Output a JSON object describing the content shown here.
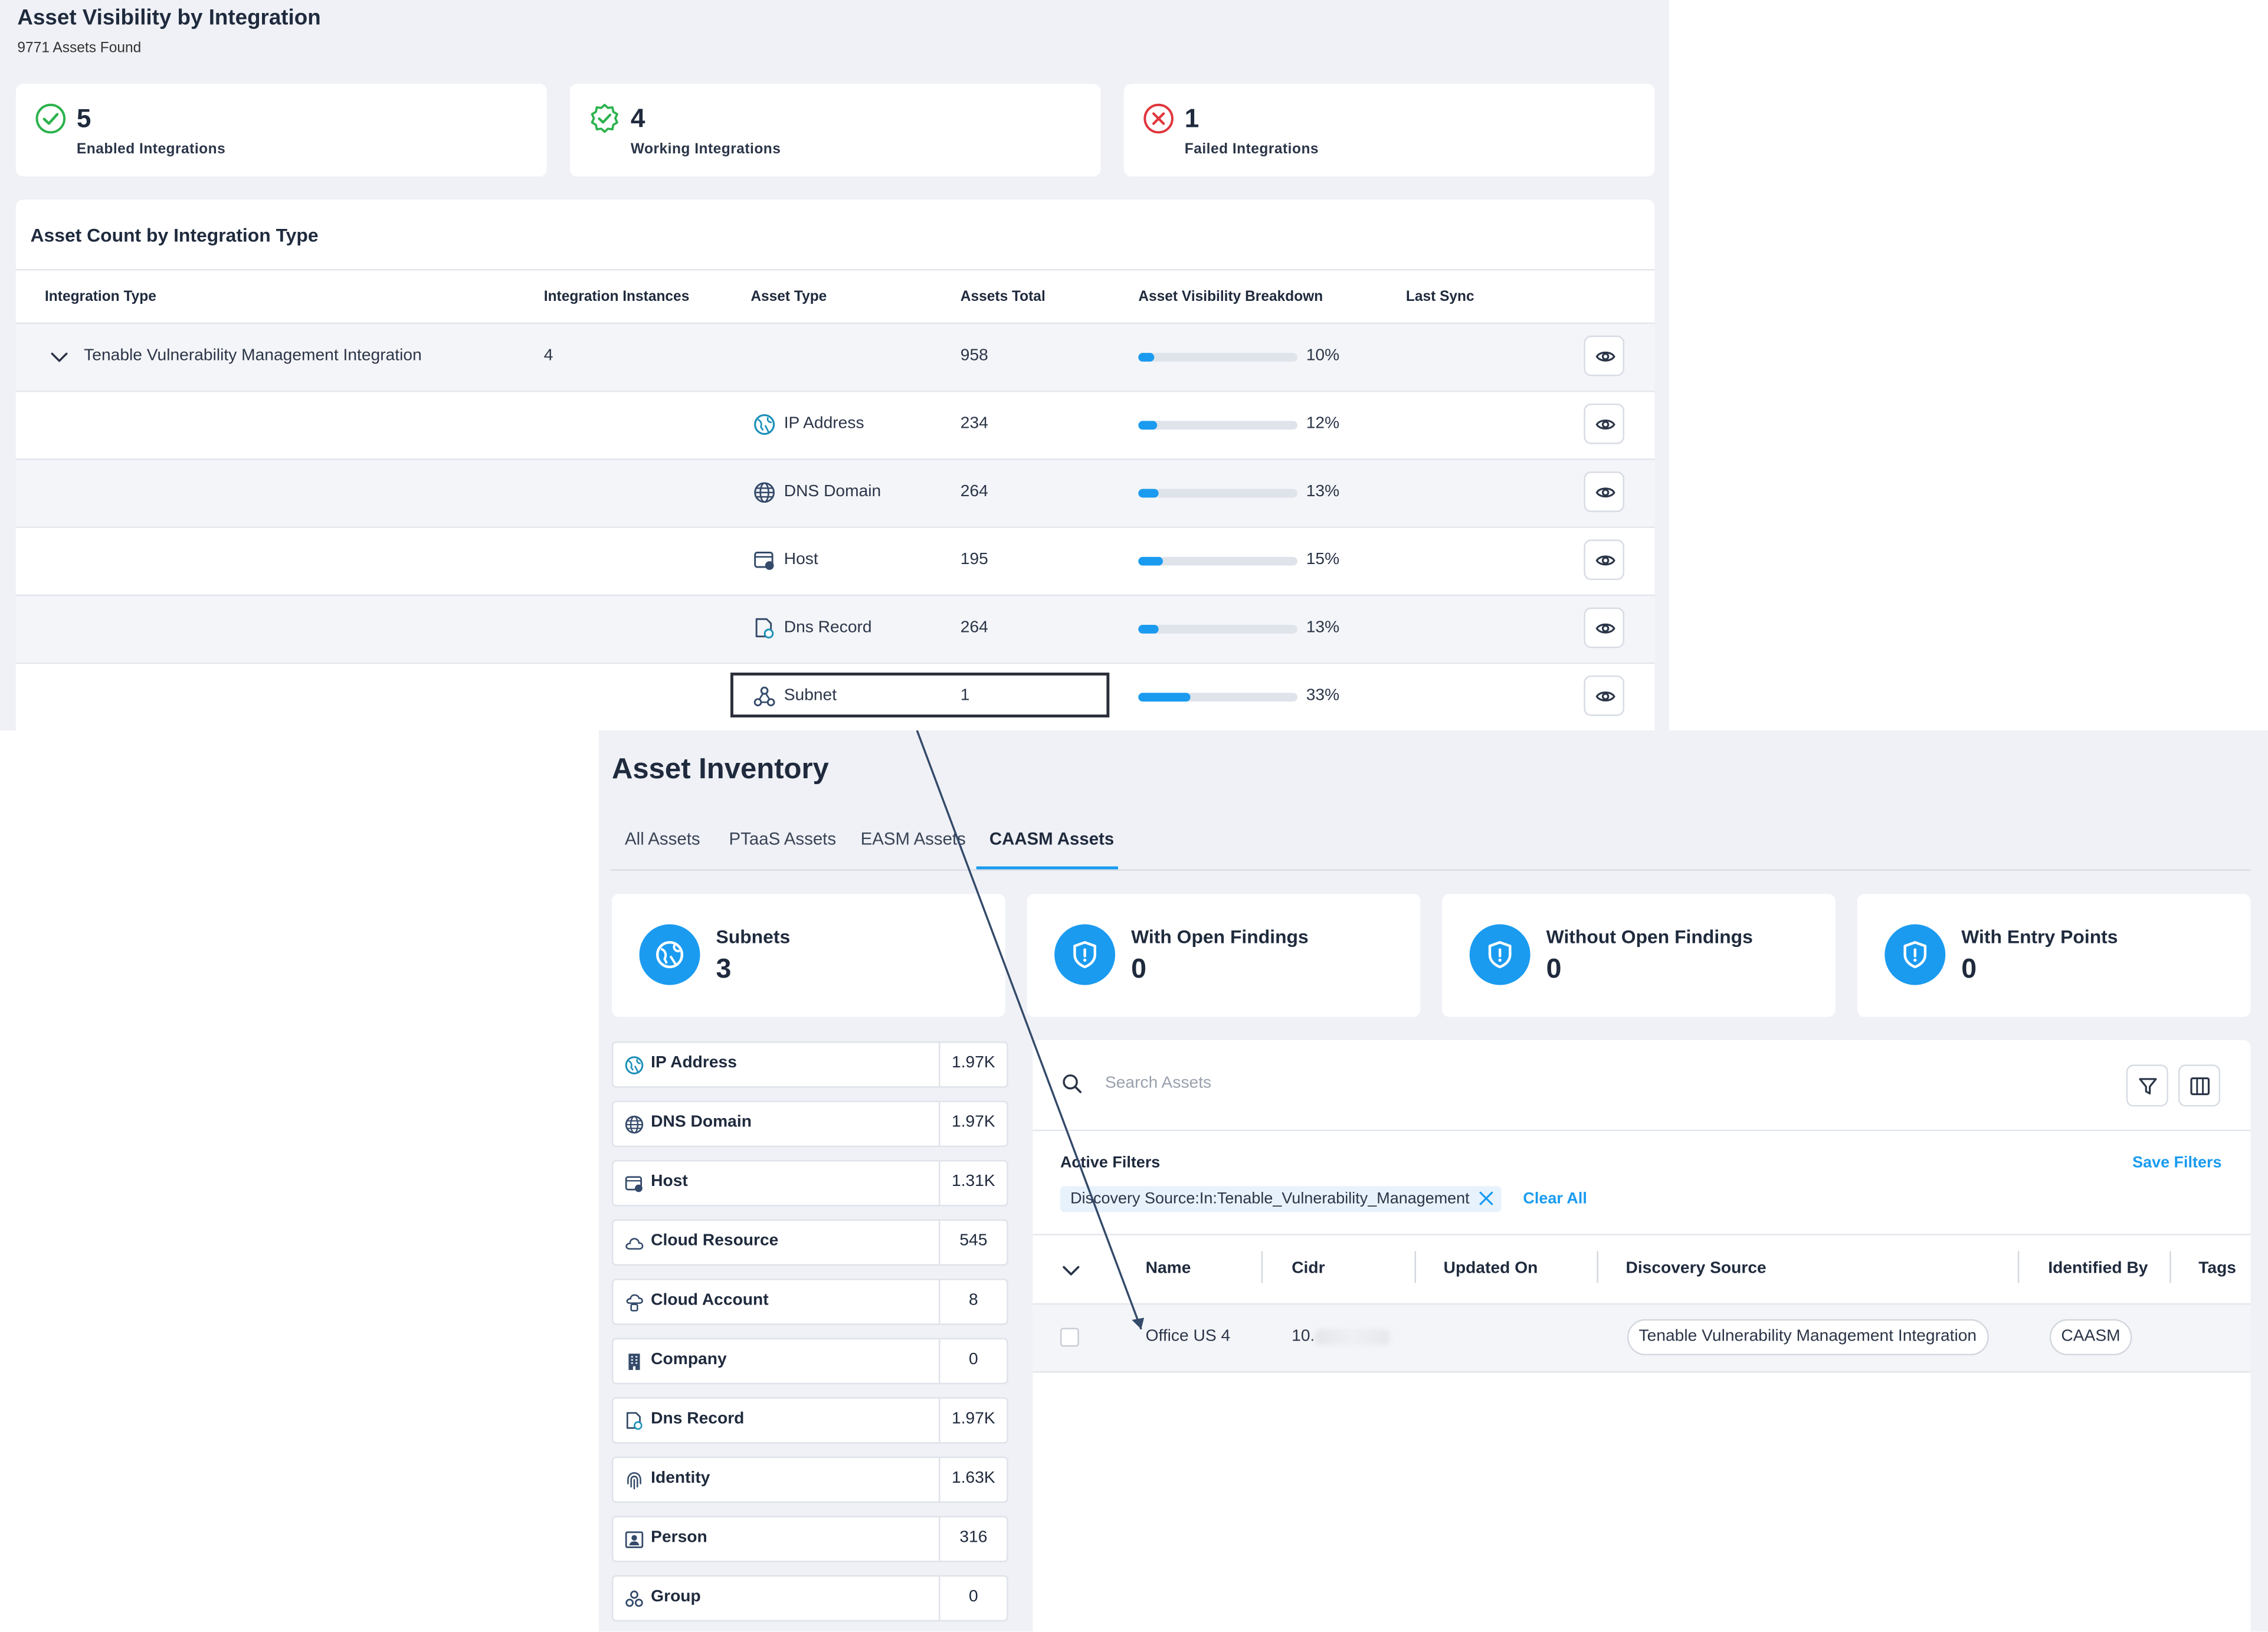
{
  "visibility": {
    "title": "Asset Visibility by Integration",
    "assets_found": "9771 Assets Found",
    "stats": [
      {
        "icon": "check-circle-icon",
        "value": "5",
        "label": "Enabled Integrations",
        "color": "#2bb24c"
      },
      {
        "icon": "verified-badge-icon",
        "value": "4",
        "label": "Working Integrations",
        "color": "#2bb24c"
      },
      {
        "icon": "failed-x-circle-icon",
        "value": "1",
        "label": "Failed Integrations",
        "color": "#e0353b"
      }
    ],
    "table": {
      "title": "Asset Count by Integration Type",
      "headers": {
        "integration_type": "Integration Type",
        "instances": "Integration Instances",
        "asset_type": "Asset Type",
        "assets_total": "Assets Total",
        "breakdown": "Asset Visibility Breakdown",
        "last_sync": "Last Sync"
      },
      "parent_row": {
        "integration": "Tenable Vulnerability Management Integration",
        "instances": "4",
        "total": "958",
        "percent": "10%",
        "fill": 0.1
      },
      "rows": [
        {
          "icon": "ip-address-icon",
          "asset_type": "IP Address",
          "total": "234",
          "percent": "12%",
          "fill": 0.12
        },
        {
          "icon": "dns-domain-globe-icon",
          "asset_type": "DNS Domain",
          "total": "264",
          "percent": "13%",
          "fill": 0.13
        },
        {
          "icon": "host-icon",
          "asset_type": "Host",
          "total": "195",
          "percent": "15%",
          "fill": 0.15
        },
        {
          "icon": "dns-record-icon",
          "asset_type": "Dns Record",
          "total": "264",
          "percent": "13%",
          "fill": 0.13
        },
        {
          "icon": "subnet-icon",
          "asset_type": "Subnet",
          "total": "1",
          "percent": "33%",
          "fill": 0.33
        }
      ]
    }
  },
  "inventory": {
    "title": "Asset Inventory",
    "tabs": [
      "All Assets",
      "PTaaS Assets",
      "EASM Assets",
      "CAASM Assets"
    ],
    "active_tab": "CAASM Assets",
    "kpis": [
      {
        "icon": "subnet-globe-icon",
        "label": "Subnets",
        "value": "3"
      },
      {
        "icon": "shield-alert-icon",
        "label": "With Open Findings",
        "value": "0"
      },
      {
        "icon": "shield-alert-icon",
        "label": "Without Open Findings",
        "value": "0"
      },
      {
        "icon": "shield-alert-icon",
        "label": "With Entry Points",
        "value": "0"
      }
    ],
    "asset_types": [
      {
        "icon": "ip-address-icon",
        "label": "IP Address",
        "count": "1.97K"
      },
      {
        "icon": "dns-domain-globe-icon",
        "label": "DNS Domain",
        "count": "1.97K"
      },
      {
        "icon": "host-icon",
        "label": "Host",
        "count": "1.31K"
      },
      {
        "icon": "cloud-icon",
        "label": "Cloud Resource",
        "count": "545"
      },
      {
        "icon": "cloud-account-icon",
        "label": "Cloud Account",
        "count": "8"
      },
      {
        "icon": "company-building-icon",
        "label": "Company",
        "count": "0"
      },
      {
        "icon": "dns-record-icon",
        "label": "Dns Record",
        "count": "1.97K"
      },
      {
        "icon": "fingerprint-icon",
        "label": "Identity",
        "count": "1.63K"
      },
      {
        "icon": "person-id-icon",
        "label": "Person",
        "count": "316"
      },
      {
        "icon": "group-icon",
        "label": "Group",
        "count": "0"
      }
    ],
    "search": {
      "placeholder": "Search Assets"
    },
    "filters": {
      "title": "Active Filters",
      "save": "Save Filters",
      "chip": "Discovery Source:In:Tenable_Vulnerability_Management",
      "clear": "Clear All"
    },
    "columns": [
      "Name",
      "Cidr",
      "Updated On",
      "Discovery Source",
      "Identified By",
      "Tags"
    ],
    "row": {
      "name": "Office US 4",
      "cidr": "10.",
      "discovery_source": "Tenable Vulnerability Management Integration",
      "identified_by": "CAASM"
    },
    "accent": "#1a9bf0"
  }
}
